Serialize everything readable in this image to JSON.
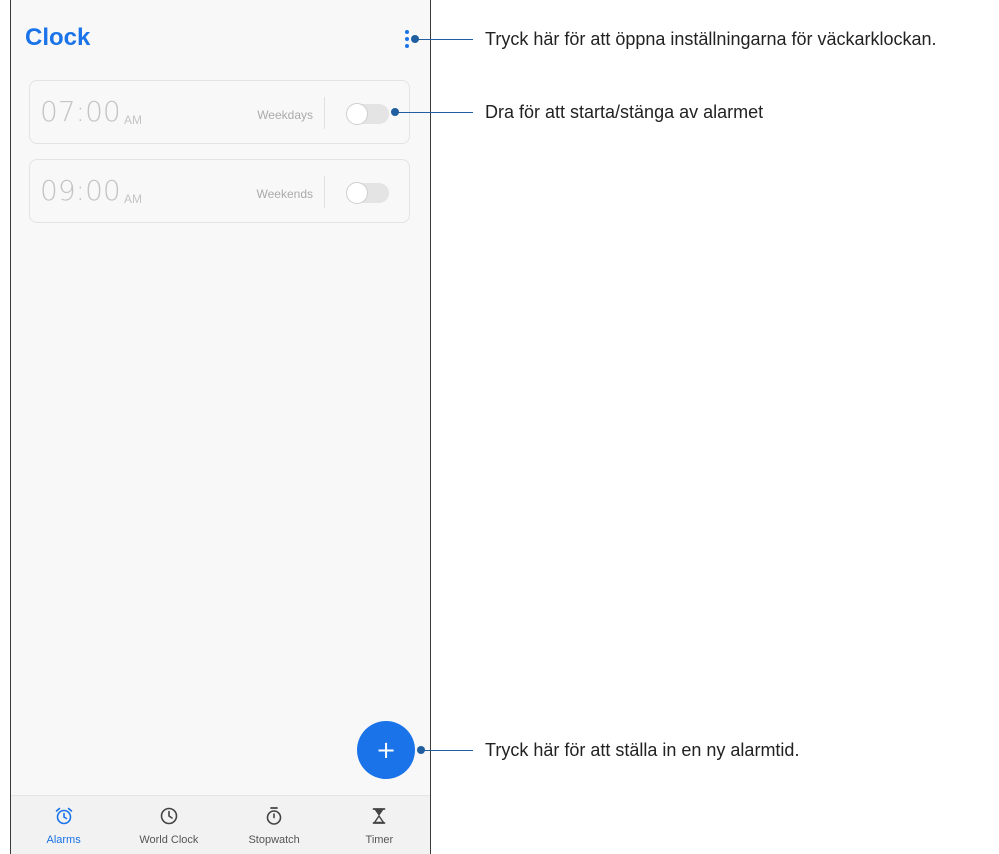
{
  "app": {
    "title": "Clock"
  },
  "alarms": [
    {
      "time": "07:00",
      "ampm": "AM",
      "days": "Weekdays",
      "enabled": false
    },
    {
      "time": "09:00",
      "ampm": "AM",
      "days": "Weekends",
      "enabled": false
    }
  ],
  "fab": {
    "label": "+"
  },
  "nav": {
    "tabs": [
      {
        "label": "Alarms",
        "icon": "alarm-clock-icon",
        "active": true
      },
      {
        "label": "World Clock",
        "icon": "clock-icon",
        "active": false
      },
      {
        "label": "Stopwatch",
        "icon": "stopwatch-icon",
        "active": false
      },
      {
        "label": "Timer",
        "icon": "hourglass-icon",
        "active": false
      }
    ]
  },
  "callouts": {
    "settings": "Tryck här för att öppna inställningarna för väckarklockan.",
    "toggle": "Dra för att starta/stänga av alarmet",
    "add": "Tryck här för att ställa in en ny alarmtid."
  },
  "colors": {
    "accent": "#1a73e8",
    "callout_line": "#1f5fa0"
  }
}
